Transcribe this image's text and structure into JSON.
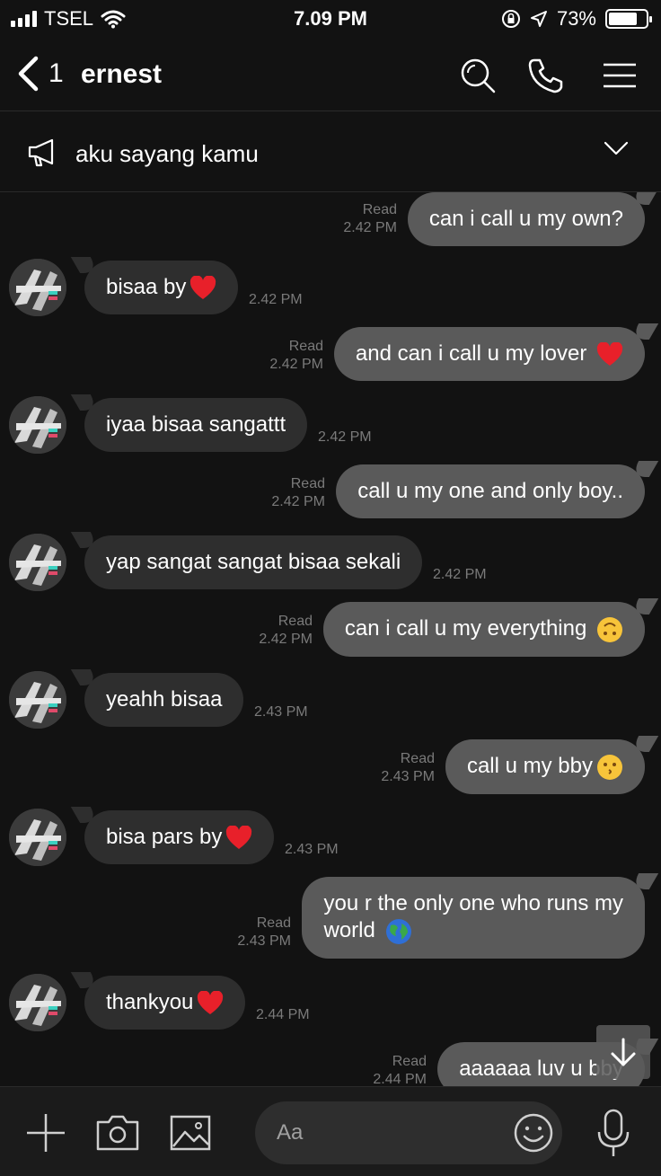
{
  "status": {
    "carrier": "TSEL",
    "time": "7.09 PM",
    "battery": "73%",
    "battery_level": 0.73
  },
  "header": {
    "back_count": "1",
    "title": "ernest"
  },
  "notice": {
    "text": "aku sayang kamu"
  },
  "messages": [
    {
      "dir": "out",
      "text": "can i call u my own?",
      "read": "Read",
      "time": "2.42 PM"
    },
    {
      "dir": "in",
      "text": "bisaa by",
      "emoji": "heart",
      "time": "2.42 PM"
    },
    {
      "dir": "out",
      "text": "and can i call u my lover ",
      "emoji": "heart",
      "read": "Read",
      "time": "2.42 PM"
    },
    {
      "dir": "in",
      "text": "iyaa bisaa sangattt",
      "time": "2.42 PM"
    },
    {
      "dir": "out",
      "text": "call u my one and only boy..",
      "read": "Read",
      "time": "2.42 PM"
    },
    {
      "dir": "in",
      "text": "yap sangat sangat bisaa sekali",
      "time": "2.42 PM"
    },
    {
      "dir": "out",
      "text": "can i call u my everything ",
      "emoji": "upside-down-face",
      "read": "Read",
      "time": "2.42 PM"
    },
    {
      "dir": "in",
      "text": "yeahh bisaa",
      "time": "2.43 PM"
    },
    {
      "dir": "out",
      "text": "call u my bby",
      "emoji": "kissing-face",
      "read": "Read",
      "time": "2.43 PM"
    },
    {
      "dir": "in",
      "text": "bisa pars by",
      "emoji": "heart",
      "time": "2.43 PM"
    },
    {
      "dir": "out",
      "text_line1": "you r the only one who runs my",
      "text_line2": "world ",
      "emoji": "globe",
      "read": "Read",
      "time": "2.43 PM"
    },
    {
      "dir": "in",
      "text": "thankyou",
      "emoji": "heart",
      "time": "2.44 PM"
    },
    {
      "dir": "out",
      "text": "aaaaaa luv u bby",
      "read": "Read",
      "time": "2.44 PM"
    }
  ],
  "input": {
    "placeholder": "Aa"
  },
  "colors": {
    "background": "#121212",
    "bubble_out": "#5a5a5a",
    "bubble_in": "#2e2e2e",
    "heart": "#e8202a"
  }
}
